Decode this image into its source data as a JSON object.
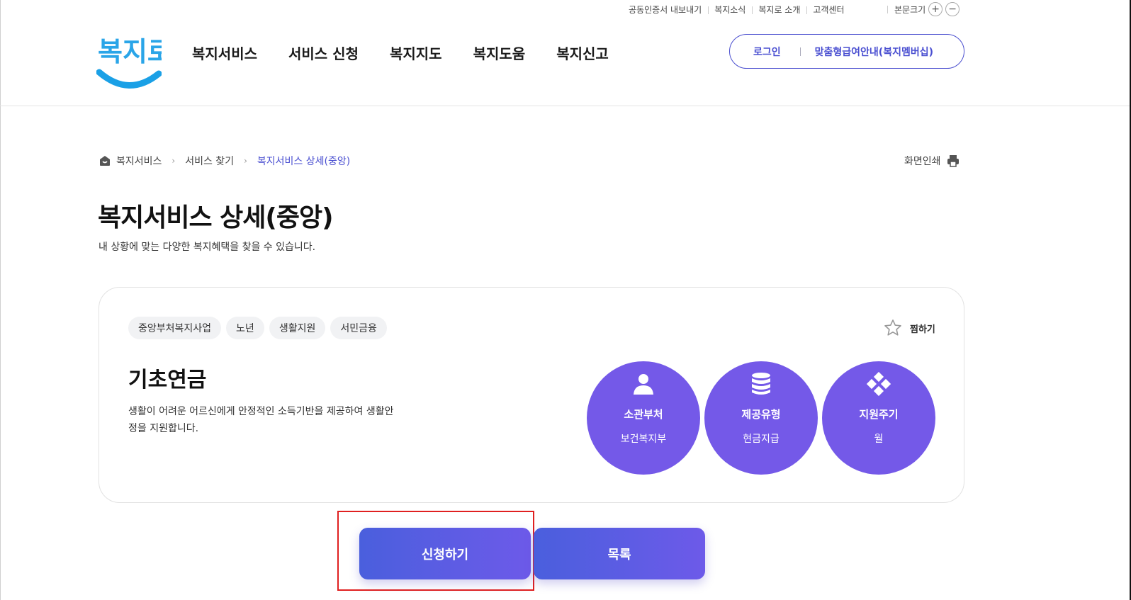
{
  "utility": {
    "links": [
      "공동인증서 내보내기",
      "복지소식",
      "복지로 소개",
      "고객센터"
    ],
    "font_size_label": "본문크기",
    "plus": "+",
    "minus": "−"
  },
  "logo": {
    "text": "복지로",
    "colors": {
      "text": "#2aa5e8",
      "smile": "#1aa0e6"
    }
  },
  "gnb": [
    "복지서비스",
    "서비스 신청",
    "복지지도",
    "복지도움",
    "복지신고"
  ],
  "login_box": {
    "login": "로그인",
    "membership": "맞춤형급여안내(복지멤버십)"
  },
  "breadcrumb": {
    "items": [
      "복지서비스",
      "서비스 찾기"
    ],
    "current": "복지서비스 상세(중앙)",
    "home_icon": "home-icon"
  },
  "print_label": "화면인쇄",
  "page": {
    "title": "복지서비스 상세(중앙)",
    "description": "내 상황에 맞는 다양한 복지혜택을 찾을 수 있습니다."
  },
  "service": {
    "tags": [
      "중앙부처복지사업",
      "노년",
      "생활지원",
      "서민금융"
    ],
    "favorite_label": "찜하기",
    "title": "기초연금",
    "description": "생활이 어려운 어르신에게 안정적인 소득기반을 제공하여 생활안정을 지원합니다.",
    "info": [
      {
        "label": "소관부처",
        "value": "보건복지부",
        "icon": "person-icon"
      },
      {
        "label": "제공유형",
        "value": "현금지급",
        "icon": "coins-icon"
      },
      {
        "label": "지원주기",
        "value": "월",
        "icon": "cycle-icon"
      }
    ]
  },
  "buttons": {
    "apply": "신청하기",
    "list": "목록"
  },
  "colors": {
    "accent": "#4a4fd1",
    "circle": "#7459e8",
    "highlight": "#e02020"
  }
}
